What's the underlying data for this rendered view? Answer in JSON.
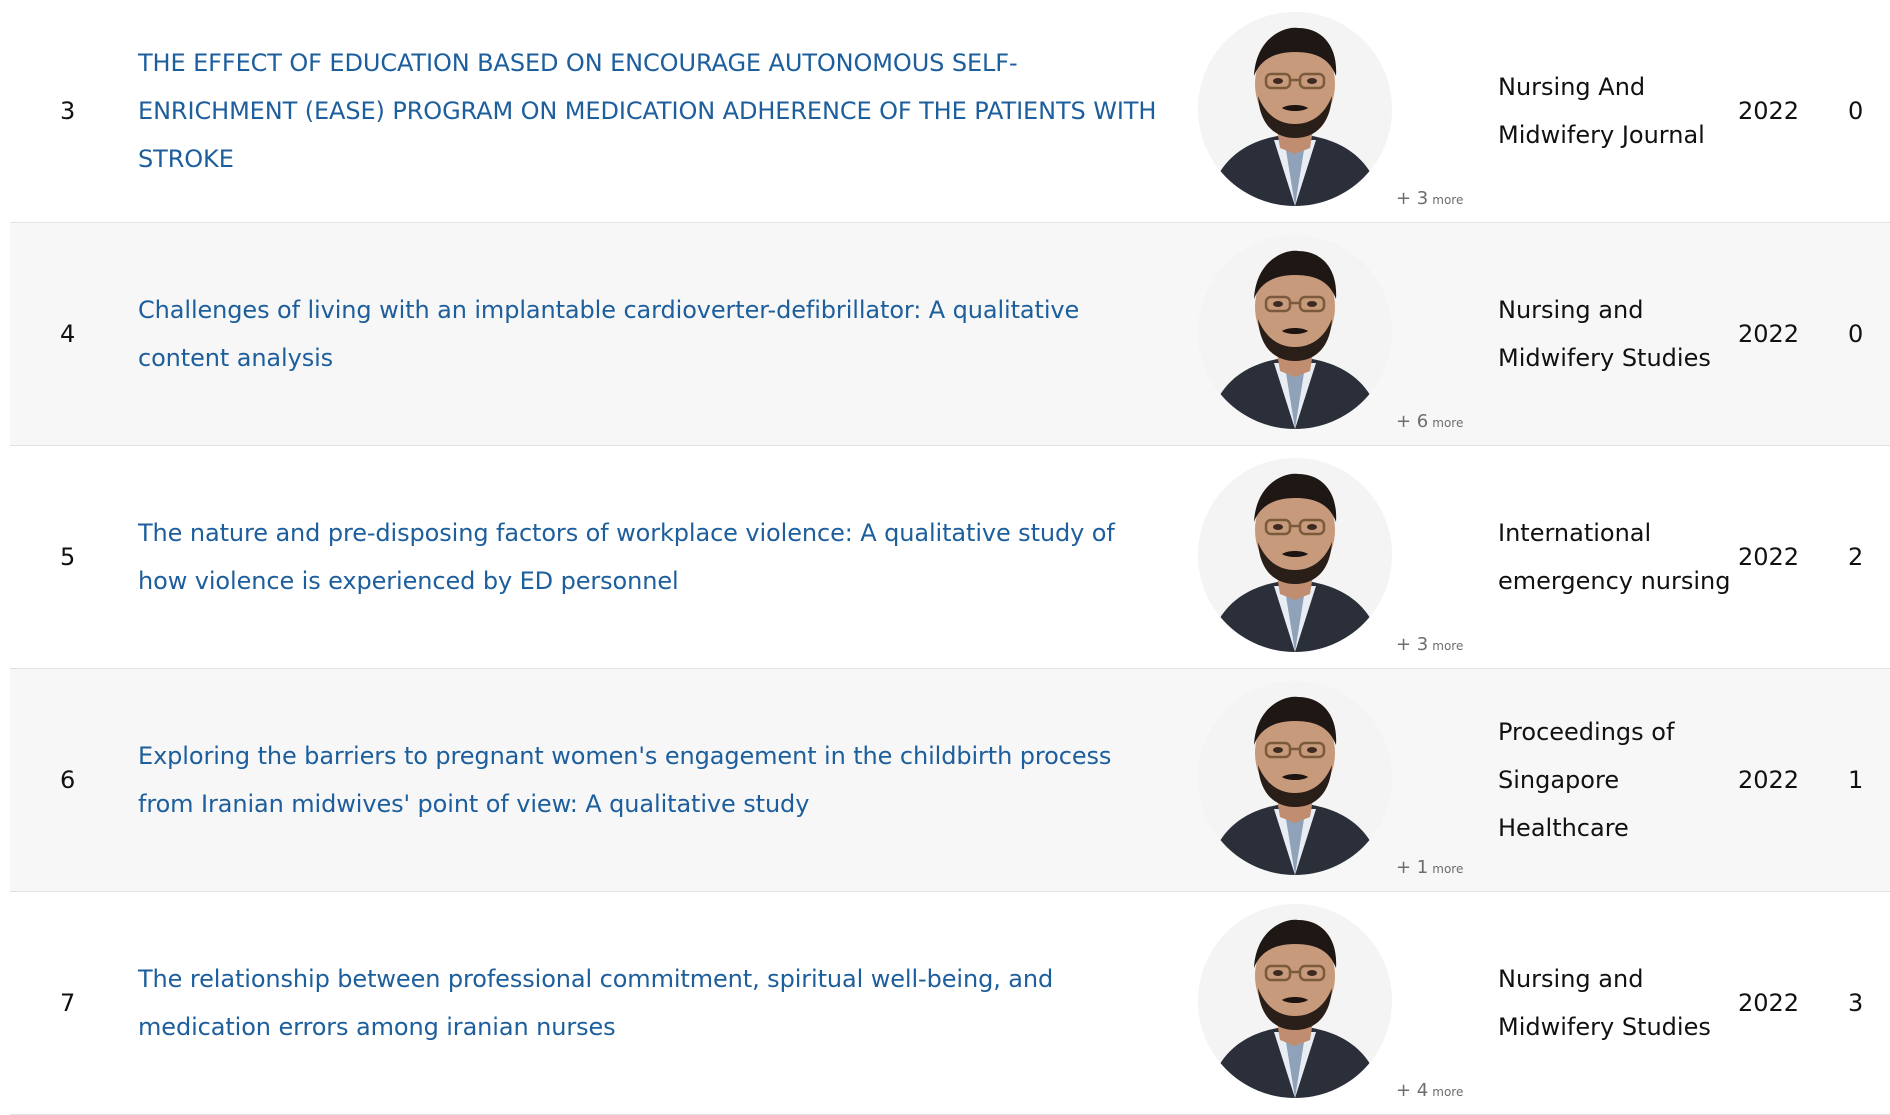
{
  "labels": {
    "more": "more"
  },
  "publications": [
    {
      "number": "3",
      "title": "THE EFFECT OF EDUCATION BASED ON ENCOURAGE AUTONOMOUS SELF-ENRICHMENT (EASE) PROGRAM ON MEDICATION ADHERENCE OF THE PATIENTS WITH STROKE",
      "more_authors": "+ 3",
      "journal": "Nursing And Midwifery Journal",
      "year": "2022",
      "citations": "0"
    },
    {
      "number": "4",
      "title": "Challenges of living with an implantable cardioverter-defibrillator: A qualitative content analysis",
      "more_authors": "+ 6",
      "journal": "Nursing and Midwifery Studies",
      "year": "2022",
      "citations": "0"
    },
    {
      "number": "5",
      "title": "The nature and pre-disposing factors of workplace violence: A qualitative study of how violence is experienced by ED personnel",
      "more_authors": "+ 3",
      "journal": "International emergency nursing",
      "year": "2022",
      "citations": "2"
    },
    {
      "number": "6",
      "title": "Exploring the barriers to pregnant women's engagement in the childbirth process from Iranian midwives' point of view: A qualitative study",
      "more_authors": "+ 1",
      "journal": "Proceedings of Singapore Healthcare",
      "year": "2022",
      "citations": "1"
    },
    {
      "number": "7",
      "title": "The relationship between professional commitment, spiritual well-being, and medication errors among iranian nurses",
      "more_authors": "+ 4",
      "journal": "Nursing and Midwifery Studies",
      "year": "2022",
      "citations": "3"
    }
  ]
}
